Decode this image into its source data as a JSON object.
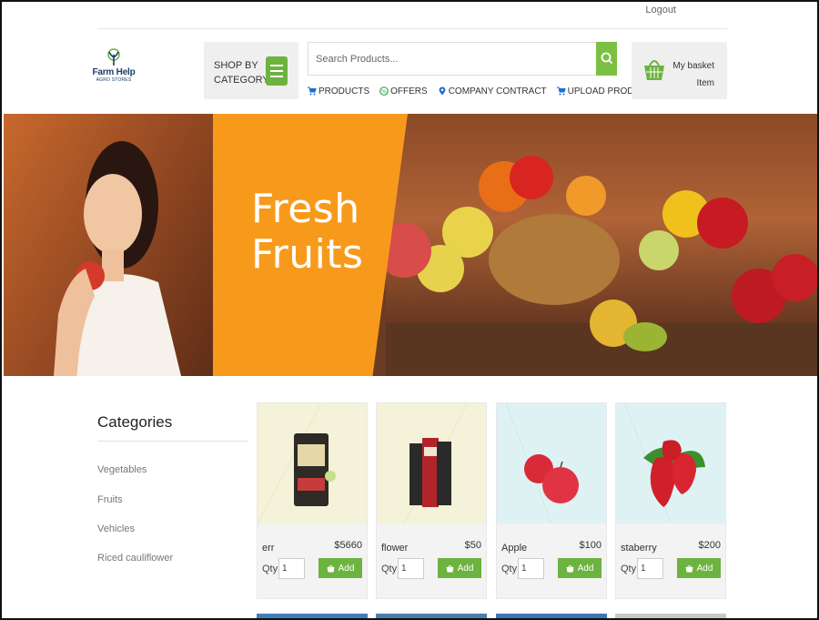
{
  "header": {
    "logout_label": "Logout",
    "logo": {
      "title": "Farm Help",
      "subtitle": "AGRO STORES"
    },
    "shop_by_category_label": "SHOP BY CATEGORY",
    "search": {
      "placeholder": "Search Products...",
      "value": ""
    },
    "nav_links": [
      {
        "label": "PRODUCTS",
        "icon": "cart-icon"
      },
      {
        "label": "OFFERS",
        "icon": "offers-icon"
      },
      {
        "label": "COMPANY CONTRACT",
        "icon": "location-pin-icon"
      },
      {
        "label": "UPLOAD PRODUCT",
        "icon": "cart-icon"
      }
    ],
    "basket": {
      "line1": "My basket",
      "line2": "Item"
    }
  },
  "banner": {
    "line1": "Fresh",
    "line2": "Fruits"
  },
  "sidebar": {
    "heading": "Categories",
    "items": [
      "Vegetables",
      "Fruits",
      "Vehicles",
      "Riced cauliflower"
    ]
  },
  "products": [
    {
      "name": "err",
      "price": "$5660",
      "qty_label": "Qty",
      "qty": "1",
      "add_label": "Add"
    },
    {
      "name": "flower",
      "price": "$50",
      "qty_label": "Qty",
      "qty": "1",
      "add_label": "Add"
    },
    {
      "name": "Apple",
      "price": "$100",
      "qty_label": "Qty",
      "qty": "1",
      "add_label": "Add"
    },
    {
      "name": "staberry",
      "price": "$200",
      "qty_label": "Qty",
      "qty": "1",
      "add_label": "Add"
    }
  ],
  "colors": {
    "accent_green": "#6db33f",
    "banner_orange": "#f79a1c",
    "logo_navy": "#1b3c6b"
  }
}
